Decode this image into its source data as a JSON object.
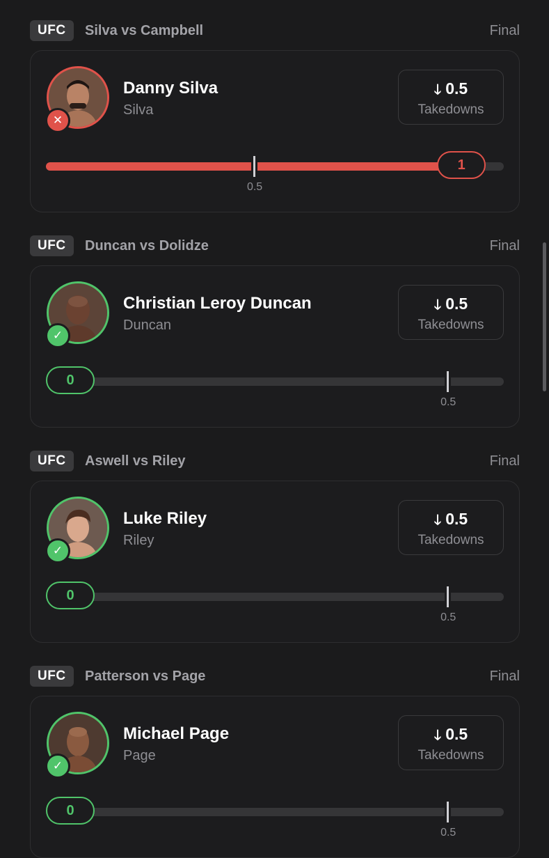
{
  "colors": {
    "loss": "#e0524a",
    "win": "#50c46a",
    "background": "#1b1b1c"
  },
  "groups": [
    {
      "league": "UFC",
      "matchup": "Silva vs Campbell",
      "status": "Final",
      "player": {
        "name": "Danny Silva",
        "short": "Silva"
      },
      "result": "loss",
      "result_icon": "x-icon",
      "prop": {
        "direction": "under",
        "line": "0.5",
        "stat": "Takedowns"
      },
      "progress": {
        "actual": 1,
        "actual_label": "1",
        "threshold": 0.5,
        "threshold_label": "0.5",
        "max": 1.1
      }
    },
    {
      "league": "UFC",
      "matchup": "Duncan vs Dolidze",
      "status": "Final",
      "player": {
        "name": "Christian Leroy Duncan",
        "short": "Duncan"
      },
      "result": "win",
      "result_icon": "check-icon",
      "prop": {
        "direction": "under",
        "line": "0.5",
        "stat": "Takedowns"
      },
      "progress": {
        "actual": 0,
        "actual_label": "0",
        "threshold": 0.5,
        "threshold_label": "0.5",
        "max": 0.57
      }
    },
    {
      "league": "UFC",
      "matchup": "Aswell vs Riley",
      "status": "Final",
      "player": {
        "name": "Luke Riley",
        "short": "Riley"
      },
      "result": "win",
      "result_icon": "check-icon",
      "prop": {
        "direction": "under",
        "line": "0.5",
        "stat": "Takedowns"
      },
      "progress": {
        "actual": 0,
        "actual_label": "0",
        "threshold": 0.5,
        "threshold_label": "0.5",
        "max": 0.57
      }
    },
    {
      "league": "UFC",
      "matchup": "Patterson vs Page",
      "status": "Final",
      "player": {
        "name": "Michael Page",
        "short": "Page"
      },
      "result": "win",
      "result_icon": "check-icon",
      "prop": {
        "direction": "under",
        "line": "0.5",
        "stat": "Takedowns"
      },
      "progress": {
        "actual": 0,
        "actual_label": "0",
        "threshold": 0.5,
        "threshold_label": "0.5",
        "max": 0.57
      }
    }
  ]
}
